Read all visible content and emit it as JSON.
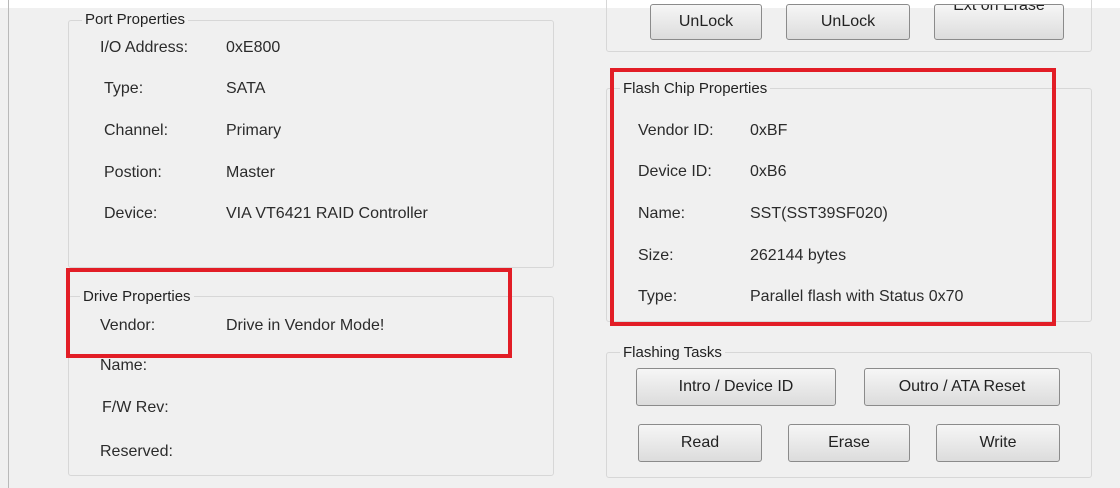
{
  "port_properties": {
    "title": "Port Properties",
    "rows": [
      {
        "label": "I/O Address:",
        "value": "0xE800"
      },
      {
        "label": "Type:",
        "value": "SATA"
      },
      {
        "label": "Channel:",
        "value": "Primary"
      },
      {
        "label": "Postion:",
        "value": "Master"
      },
      {
        "label": "Device:",
        "value": "VIA VT6421 RAID Controller"
      }
    ]
  },
  "drive_properties": {
    "title": "Drive Properties",
    "rows": [
      {
        "label": "Vendor:",
        "value": "Drive in Vendor Mode!"
      },
      {
        "label": "Name:",
        "value": ""
      },
      {
        "label": "F/W Rev:",
        "value": ""
      },
      {
        "label": "Reserved:",
        "value": ""
      }
    ]
  },
  "lock_buttons": [
    {
      "label": "UnLock"
    },
    {
      "label": "UnLock"
    },
    {
      "label": "Ext on Erase"
    }
  ],
  "flash_chip_properties": {
    "title": "Flash Chip Properties",
    "rows": [
      {
        "label": "Vendor ID:",
        "value": "0xBF"
      },
      {
        "label": "Device ID:",
        "value": "0xB6"
      },
      {
        "label": "Name:",
        "value": "SST(SST39SF020)"
      },
      {
        "label": "Size:",
        "value": "262144 bytes"
      },
      {
        "label": "Type:",
        "value": "Parallel flash with Status 0x70"
      }
    ]
  },
  "flashing_tasks": {
    "title": "Flashing Tasks",
    "intro_label": "Intro / Device ID",
    "outro_label": "Outro / ATA Reset",
    "read_label": "Read",
    "erase_label": "Erase",
    "write_label": "Write"
  },
  "colors": {
    "highlight": "#e21d26",
    "window_bg": "#f0f0f0"
  }
}
